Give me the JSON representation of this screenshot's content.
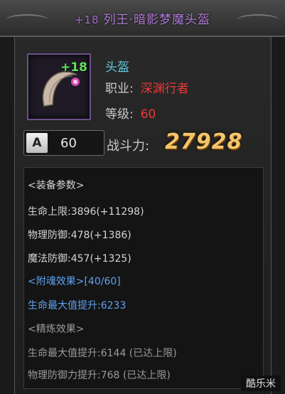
{
  "header": {
    "enhance": "+18",
    "title": "列王·暗影梦魔头盔"
  },
  "item": {
    "enhance_badge": "+18",
    "type": "头盔",
    "class_label": "职业:",
    "class_value": "深渊行者",
    "level_label": "等级:",
    "level_value": "60"
  },
  "grade": {
    "letter": "A",
    "value": "60"
  },
  "power": {
    "label": "战斗力:",
    "value": "27928"
  },
  "stats": {
    "section_params": "<装备参数>",
    "hp": "生命上限:3896(+11298)",
    "pdef": "物理防御:478(+1386)",
    "mdef": "魔法防御:457(+1325)",
    "section_soul": "<附魂效果>[40/60]",
    "soul_1": "生命最大值提升:6233",
    "section_refine": "<精炼效果>",
    "refine_1": "生命最大值提升:6144 (已达上限)",
    "refine_2": "物理防御力提升:768 (已达上限)"
  },
  "watermark": "酷乐米"
}
